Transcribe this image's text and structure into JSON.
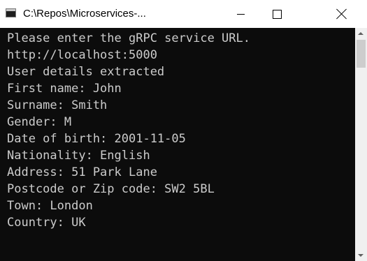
{
  "window": {
    "title": "C:\\Repos\\Microservices-...",
    "app_icon": "console-app-icon",
    "controls": {
      "minimize_icon": "minimize-icon",
      "maximize_icon": "maximize-icon",
      "close_icon": "close-icon"
    }
  },
  "console": {
    "background": "#0c0c0c",
    "foreground": "#cccccc",
    "lines": [
      "Please enter the gRPC service URL.",
      "http://localhost:5000",
      "User details extracted",
      "First name: John",
      "Surname: Smith",
      "Gender: M",
      "Date of birth: 2001-11-05",
      "Nationality: English",
      "Address: 51 Park Lane",
      "Postcode or Zip code: SW2 5BL",
      "Town: London",
      "Country: UK"
    ]
  }
}
